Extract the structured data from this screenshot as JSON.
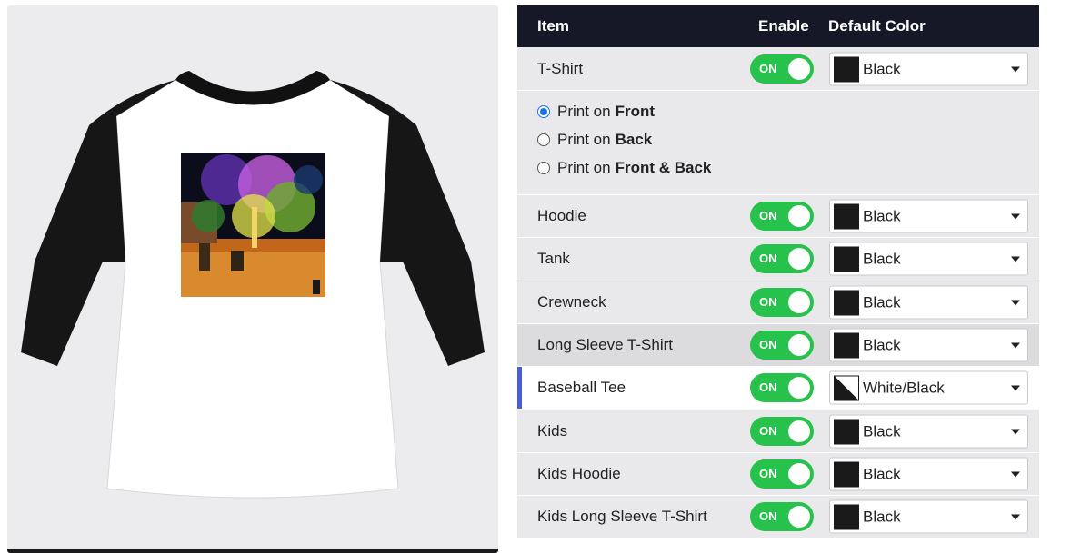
{
  "preview": {
    "product_image": "baseball-tee-white-black",
    "artwork": "night-plaza-illuminated-trees"
  },
  "table": {
    "headers": {
      "item": "Item",
      "enable": "Enable",
      "default_color": "Default Color"
    },
    "rows": [
      {
        "label": "T-Shirt",
        "toggle": "ON",
        "color": "Black",
        "swatch": "#1a1a1a"
      },
      {
        "label": "Hoodie",
        "toggle": "ON",
        "color": "Black",
        "swatch": "#1a1a1a"
      },
      {
        "label": "Tank",
        "toggle": "ON",
        "color": "Black",
        "swatch": "#1a1a1a"
      },
      {
        "label": "Crewneck",
        "toggle": "ON",
        "color": "Black",
        "swatch": "#1a1a1a"
      },
      {
        "label": "Long Sleeve T-Shirt",
        "toggle": "ON",
        "color": "Black",
        "swatch": "#1a1a1a"
      },
      {
        "label": "Baseball Tee",
        "toggle": "ON",
        "color": "White/Black",
        "swatch": "white-black-split"
      },
      {
        "label": "Kids",
        "toggle": "ON",
        "color": "Black",
        "swatch": "#1a1a1a"
      },
      {
        "label": "Kids Hoodie",
        "toggle": "ON",
        "color": "Black",
        "swatch": "#1a1a1a"
      },
      {
        "label": "Kids Long Sleeve T-Shirt",
        "toggle": "ON",
        "color": "Black",
        "swatch": "#1a1a1a"
      }
    ],
    "print_options": [
      {
        "prefix": "Print on",
        "emphasis": "Front",
        "checked": true
      },
      {
        "prefix": "Print on",
        "emphasis": "Back",
        "checked": false
      },
      {
        "prefix": "Print on",
        "emphasis": "Front & Back",
        "checked": false
      }
    ]
  },
  "colors": {
    "header_bg": "#161827",
    "toggle_on": "#27c24c",
    "active_indicator": "#4a5fd6",
    "row_bg": "#e9e9eb",
    "radio_checked": "#1a73e8"
  }
}
